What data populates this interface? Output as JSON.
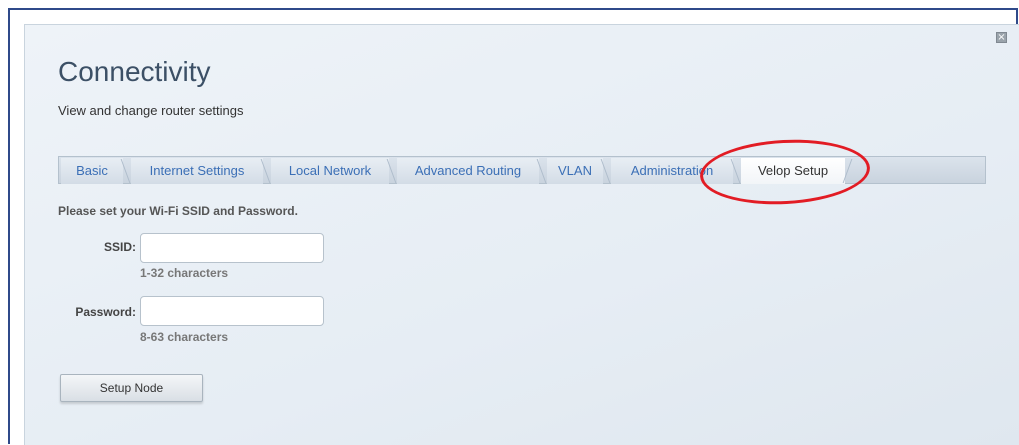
{
  "page": {
    "title": "Connectivity",
    "subtitle": "View and change router settings",
    "close_icon": "close-icon"
  },
  "tabs": [
    {
      "label": "Basic",
      "active": false
    },
    {
      "label": "Internet Settings",
      "active": false
    },
    {
      "label": "Local Network",
      "active": false
    },
    {
      "label": "Advanced Routing",
      "active": false
    },
    {
      "label": "VLAN",
      "active": false
    },
    {
      "label": "Administration",
      "active": false
    },
    {
      "label": "Velop Setup",
      "active": true
    }
  ],
  "form": {
    "instructions": "Please set your Wi-Fi SSID and Password.",
    "ssid": {
      "label": "SSID:",
      "value": "",
      "hint": "1-32 characters"
    },
    "password": {
      "label": "Password:",
      "value": "",
      "hint": "8-63 characters"
    },
    "submit_label": "Setup Node"
  },
  "colors": {
    "accent_link": "#3b6fb6",
    "title": "#3c5066",
    "annotation": "#e21c24",
    "frame": "#2f4a8a"
  }
}
